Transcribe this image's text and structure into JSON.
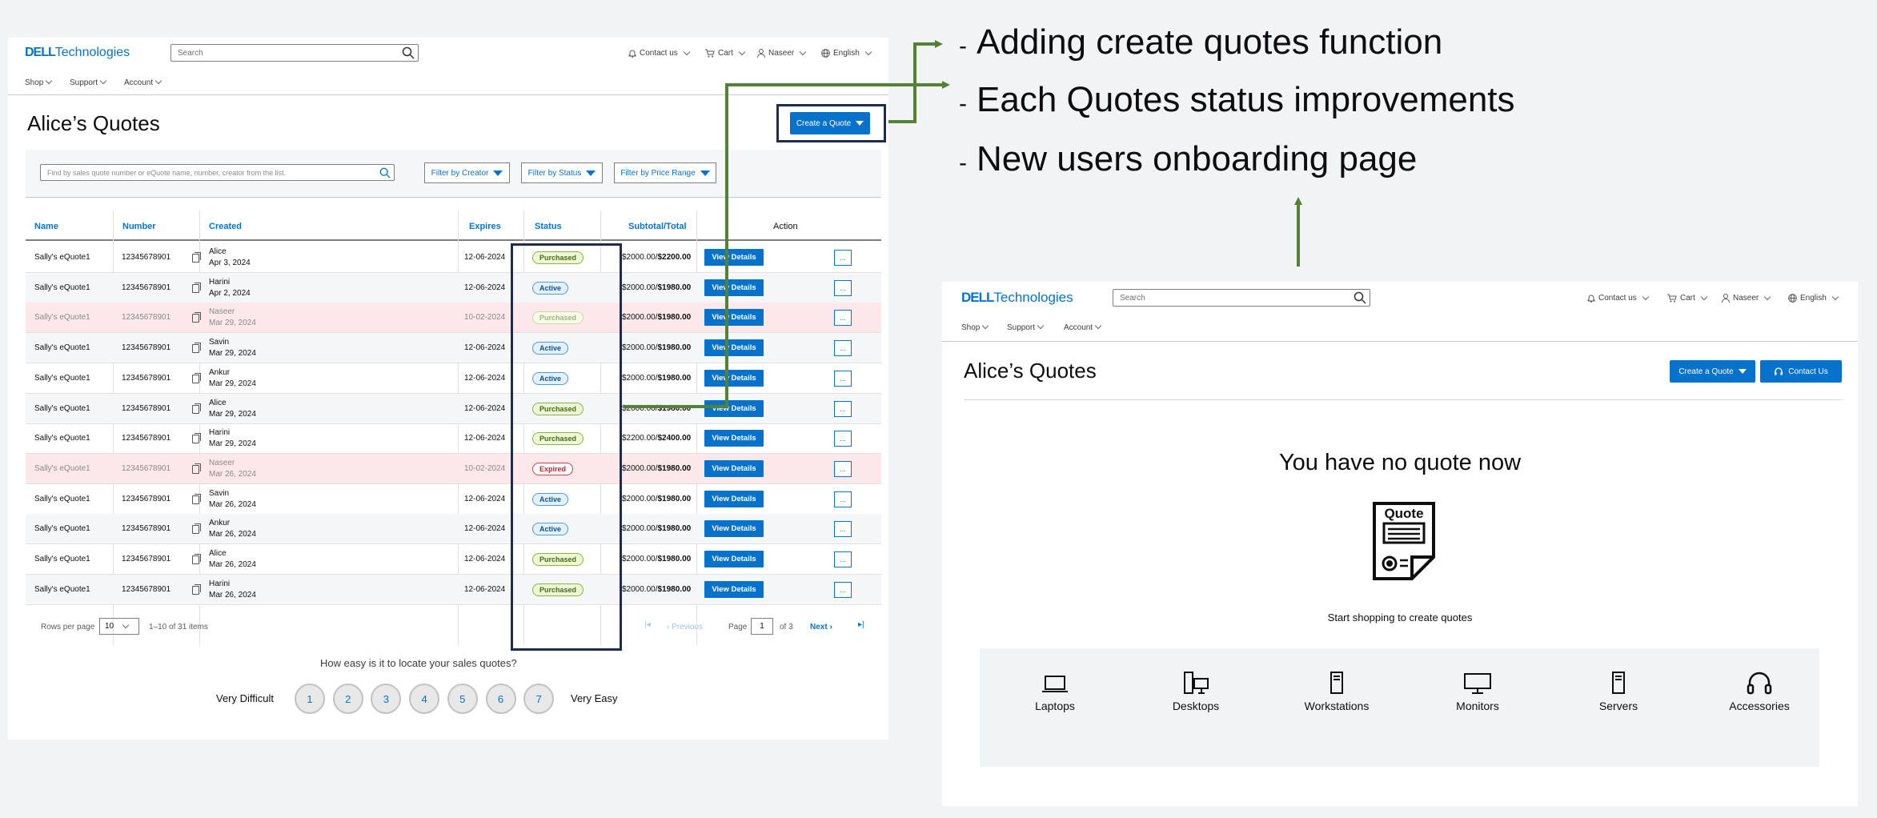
{
  "annotations": {
    "bullet": "-",
    "items": [
      "Adding create quotes function",
      "Each Quotes status improvements",
      "New users onboarding page"
    ]
  },
  "left_screen": {
    "header": {
      "logo_bold": "DELL",
      "logo_rest": "Technologies",
      "search_placeholder": "Search",
      "contact": "Contact us",
      "cart": "Cart",
      "user": "Naseer",
      "language": "English"
    },
    "nav": [
      "Shop",
      "Support",
      "Account"
    ],
    "page_title": "Alice’s Quotes",
    "create_quote": "Create a Quote",
    "find_placeholder": "Find by sales quote number or eQuote name, number, creator from the list.",
    "filters": [
      "Filter by Creator",
      "Filter by Status",
      "Filter by Price Range"
    ],
    "columns": {
      "name": "Name",
      "number": "Number",
      "created": "Created",
      "expires": "Expires",
      "status": "Status",
      "total": "Subtotal/Total",
      "action": "Action"
    },
    "view_details": "View Details",
    "more": "...",
    "rows": [
      {
        "name": "Sally's eQuote1",
        "number": "12345678901",
        "creator": "Alice",
        "date": "Apr 3, 2024",
        "expires": "12-06-2024",
        "status": "Purchased",
        "subtotal": "$2000.00/",
        "total": "$2200.00"
      },
      {
        "name": "Sally's eQuote1",
        "number": "12345678901",
        "creator": "Harini",
        "date": "Apr 2, 2024",
        "expires": "12-06-2024",
        "status": "Active",
        "subtotal": "$2000.00/",
        "total": "$1980.00"
      },
      {
        "name": "Sally's eQuote1",
        "number": "12345678901",
        "creator": "Naseer",
        "date": "Mar 29, 2024",
        "expires": "10-02-2024",
        "status": "Purchased",
        "subtotal": "$2000.00/",
        "total": "$1980.00"
      },
      {
        "name": "Sally's eQuote1",
        "number": "12345678901",
        "creator": "Savin",
        "date": "Mar 29, 2024",
        "expires": "12-06-2024",
        "status": "Active",
        "subtotal": "$2000.00/",
        "total": "$1980.00"
      },
      {
        "name": "Sally's eQuote1",
        "number": "12345678901",
        "creator": "Ankur",
        "date": "Mar 29, 2024",
        "expires": "12-06-2024",
        "status": "Active",
        "subtotal": "$2000.00/",
        "total": "$1980.00"
      },
      {
        "name": "Sally's eQuote1",
        "number": "12345678901",
        "creator": "Alice",
        "date": "Mar 29, 2024",
        "expires": "12-06-2024",
        "status": "Purchased",
        "subtotal": "$2000.00/",
        "total": "$1980.00"
      },
      {
        "name": "Sally's eQuote1",
        "number": "12345678901",
        "creator": "Harini",
        "date": "Mar 29, 2024",
        "expires": "12-06-2024",
        "status": "Purchased",
        "subtotal": "$2200.00/",
        "total": "$2400.00"
      },
      {
        "name": "Sally's eQuote1",
        "number": "12345678901",
        "creator": "Naseer",
        "date": "Mar 26, 2024",
        "expires": "10-02-2024",
        "status": "Expired",
        "subtotal": "$2000.00/",
        "total": "$1980.00"
      },
      {
        "name": "Sally's eQuote1",
        "number": "12345678901",
        "creator": "Savin",
        "date": "Mar 26, 2024",
        "expires": "12-06-2024",
        "status": "Active",
        "subtotal": "$2000.00/",
        "total": "$1980.00"
      },
      {
        "name": "Sally's eQuote1",
        "number": "12345678901",
        "creator": "Ankur",
        "date": "Mar 26, 2024",
        "expires": "12-06-2024",
        "status": "Active",
        "subtotal": "$2000.00/",
        "total": "$1980.00"
      },
      {
        "name": "Sally's eQuote1",
        "number": "12345678901",
        "creator": "Alice",
        "date": "Mar 26, 2024",
        "expires": "12-06-2024",
        "status": "Purchased",
        "subtotal": "$2000.00/",
        "total": "$1980.00"
      },
      {
        "name": "Sally's eQuote1",
        "number": "12345678901",
        "creator": "Harini",
        "date": "Mar 26, 2024",
        "expires": "12-06-2024",
        "status": "Purchased",
        "subtotal": "$2000.00/",
        "total": "$1980.00"
      }
    ],
    "pagination": {
      "rows_per_page_label": "Rows per page",
      "rows_per_page": "10",
      "range": "1–10 of 31 items",
      "previous": "Previous",
      "page_label": "Page",
      "page": "1",
      "of": "of 3",
      "next": "Next"
    },
    "survey": {
      "question": "How easy is it to locate your sales quotes?",
      "low": "Very Difficult",
      "high": "Very Easy",
      "options": [
        "1",
        "2",
        "3",
        "4",
        "5",
        "6",
        "7"
      ]
    }
  },
  "right_screen": {
    "header": {
      "logo_bold": "DELL",
      "logo_rest": "Technologies",
      "search_placeholder": "Search",
      "contact": "Contact us",
      "cart": "Cart",
      "user": "Naseer",
      "language": "English"
    },
    "nav": [
      "Shop",
      "Support",
      "Account"
    ],
    "page_title": "Alice’s Quotes",
    "create_quote": "Create a Quote",
    "contact_us": "Contact Us",
    "empty_title": "You have no quote now",
    "quote_icon_text": "Quote",
    "empty_sub": "Start shopping to create quotes",
    "categories": [
      "Laptops",
      "Desktops",
      "Workstations",
      "Monitors",
      "Servers",
      "Accessories"
    ]
  },
  "colors": {
    "accent": "#0672cb",
    "arrow_green": "#548235",
    "highlight_box": "#1f2d4d",
    "expired_row": "#fce8ea"
  }
}
